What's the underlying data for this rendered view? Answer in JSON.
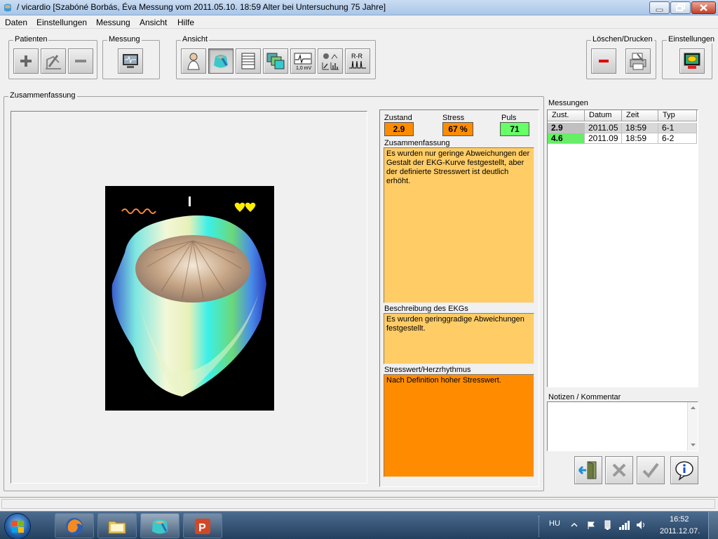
{
  "window": {
    "title": "/ vicardio [Szabóné Borbás, Éva Messung vom 2011.05.10. 18:59 Alter bei Untersuchung 75 Jahre]"
  },
  "menu": {
    "items": [
      "Daten",
      "Einstellungen",
      "Messung",
      "Ansicht",
      "Hilfe"
    ]
  },
  "toolbar": {
    "patienten_label": "Patienten",
    "messung_label": "Messung",
    "ansicht_label": "Ansicht",
    "loeschen_label": "Löschen/Drucken",
    "einstellungen_label": "Einstellungen",
    "voltage_label": "1,0 mV",
    "rr_label": "R-R"
  },
  "summary_panel": {
    "label": "Zusammenfassung"
  },
  "model_view": {
    "icon_names": [
      "ecg-wave-icon",
      "cursor-bar-icon",
      "hearts-icon"
    ]
  },
  "metrics": {
    "zustand_label": "Zustand",
    "zustand_value": "2.9",
    "stress_label": "Stress",
    "stress_value": "67 %",
    "puls_label": "Puls",
    "puls_value": "71",
    "colors": {
      "zustand": "#ff8c00",
      "stress": "#ff8c00",
      "puls": "#66ff66"
    }
  },
  "texts": {
    "zusammenfassung_label": "Zusammenfassung",
    "zusammenfassung_text": "Es wurden nur geringe Abweichungen der Gestalt der EKG-Kurve festgestellt, aber der definierte Stresswert ist deutlich erhöht.",
    "beschreibung_label": "Beschreibung des EKGs",
    "beschreibung_text": "Es wurden geringgradige Abweichungen festgestellt.",
    "stresswert_label": "Stresswert/Herzrhythmus",
    "stresswert_text": "Nach Definition hoher Stresswert.",
    "colors": {
      "light": "#ffcc66",
      "strong": "#ff8c00"
    }
  },
  "messungen": {
    "label": "Messungen",
    "columns": [
      "Zust.",
      "Datum",
      "Zeit",
      "Typ"
    ],
    "rows": [
      {
        "zust": "2.9",
        "datum": "2011.05",
        "zeit": "18:59",
        "typ": "6-1",
        "color": "#c0c0c0"
      },
      {
        "zust": "4.6",
        "datum": "2011.09",
        "zeit": "18:59",
        "typ": "6-2",
        "color": "#66ee66"
      }
    ]
  },
  "notizen": {
    "label": "Notizen / Kommentar",
    "value": ""
  },
  "taskbar": {
    "language": "HU",
    "time": "16:52",
    "date": "2011.12.07."
  }
}
